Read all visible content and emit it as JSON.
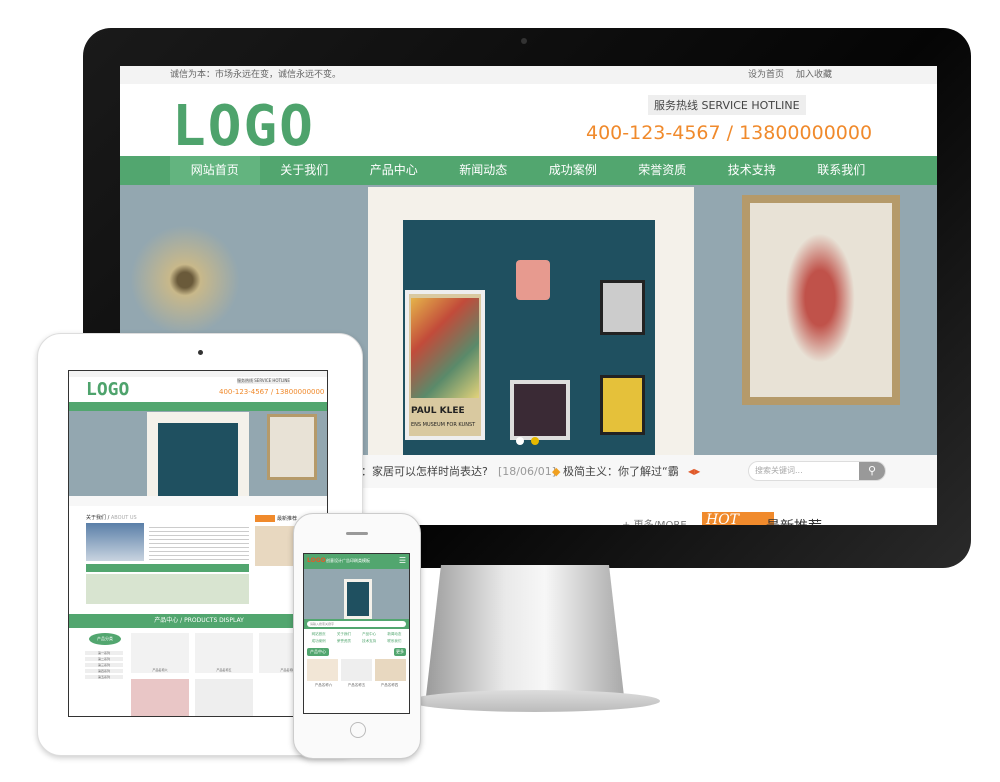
{
  "topbar": {
    "slogan": "诚信为本：市场永远在变，诚信永远不变。",
    "links": [
      "设为首页",
      "加入收藏"
    ]
  },
  "header": {
    "logo": "LOGO",
    "hotline_label": "服务热线 SERVICE HOTLINE",
    "phone": "400-123-4567 / 13800000000"
  },
  "nav": [
    "网站首页",
    "关于我们",
    "产品中心",
    "新闻动态",
    "成功案例",
    "荣誉资质",
    "技术支持",
    "联系我们"
  ],
  "banner": {
    "poster_text": "PAUL KLEE",
    "poster_sub": "ENS MUSEUM FOR KUNST"
  },
  "notice": {
    "item1": "列：家居可以怎样时尚表达?",
    "date1": "[18/06/01]",
    "item2": "极简主义：你了解过“霸",
    "search_placeholder": "搜索关键词..."
  },
  "section": {
    "more": "+ 更多/MORE",
    "hot": "HOT",
    "latest": "最新推荐"
  },
  "tablet": {
    "logo": "LOGO",
    "phone": "400-123-4567 / 13800000000",
    "hotline": "服务热线 SERVICE HOTLINE",
    "about": "关于我们",
    "about_en": "ABOUT US",
    "products": "产品中心 / PRODUCTS DISPLAY",
    "latest": "最新推荐",
    "category": "产品分类",
    "cats": [
      "第一系列",
      "第二系列",
      "第三系列",
      "第四系列",
      "第五系列"
    ],
    "product_names": [
      "产品名称六",
      "产品名称五",
      "产品名称四"
    ]
  },
  "phone": {
    "logo": "LOGO",
    "title": "创意设计广告印刷类模板",
    "search_placeholder": "请输入搜索关键字",
    "nav": [
      "网站首页",
      "关于我们",
      "产品中心",
      "新闻动态",
      "成功案例",
      "荣誉资质",
      "技术支持",
      "联系我们"
    ],
    "products": "产品中心",
    "more": "更多",
    "product_names": [
      "产品名称六",
      "产品名称五",
      "产品名称四"
    ]
  },
  "colors": {
    "brand_green": "#52a66f",
    "accent_orange": "#f08a2c"
  }
}
